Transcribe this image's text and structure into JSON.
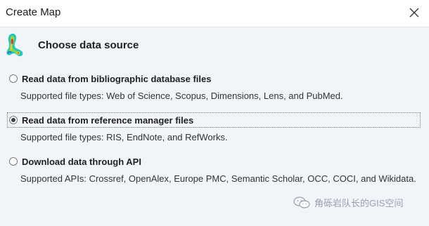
{
  "window": {
    "title": "Create Map"
  },
  "step": {
    "heading": "Choose data source"
  },
  "options": [
    {
      "label": "Read data from bibliographic database files",
      "description": "Supported file types: Web of Science, Scopus, Dimensions, Lens, and PubMed.",
      "selected": false
    },
    {
      "label": "Read data from reference manager files",
      "description": "Supported file types: RIS, EndNote, and RefWorks.",
      "selected": true
    },
    {
      "label": "Download data through API",
      "description": "Supported APIs: Crossref, OpenAlex, Europe PMC, Semantic Scholar, OCC, COCI, and Wikidata.",
      "selected": false
    }
  ],
  "watermark": {
    "text": "角砾岩队长的GIS空间"
  },
  "icons": {
    "close": "close-icon",
    "logo": "app-logo-icon",
    "watermark": "wechat-icon"
  }
}
